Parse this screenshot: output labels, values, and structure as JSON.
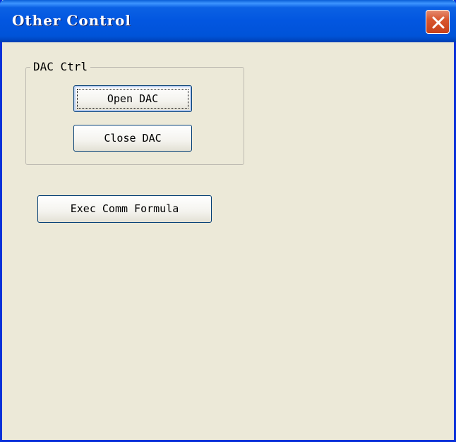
{
  "window": {
    "title": "Other Control",
    "close_icon": "close-x-icon"
  },
  "dac_group": {
    "label": "DAC Ctrl",
    "open_button": "Open DAC",
    "close_button": "Close DAC"
  },
  "exec_button": "Exec Comm Formula",
  "colors": {
    "titlebar": "#0053d8",
    "window_border": "#0831d9",
    "dialog_background": "#ece9d8",
    "close_button": "#d8562f",
    "button_border": "#003c74"
  }
}
